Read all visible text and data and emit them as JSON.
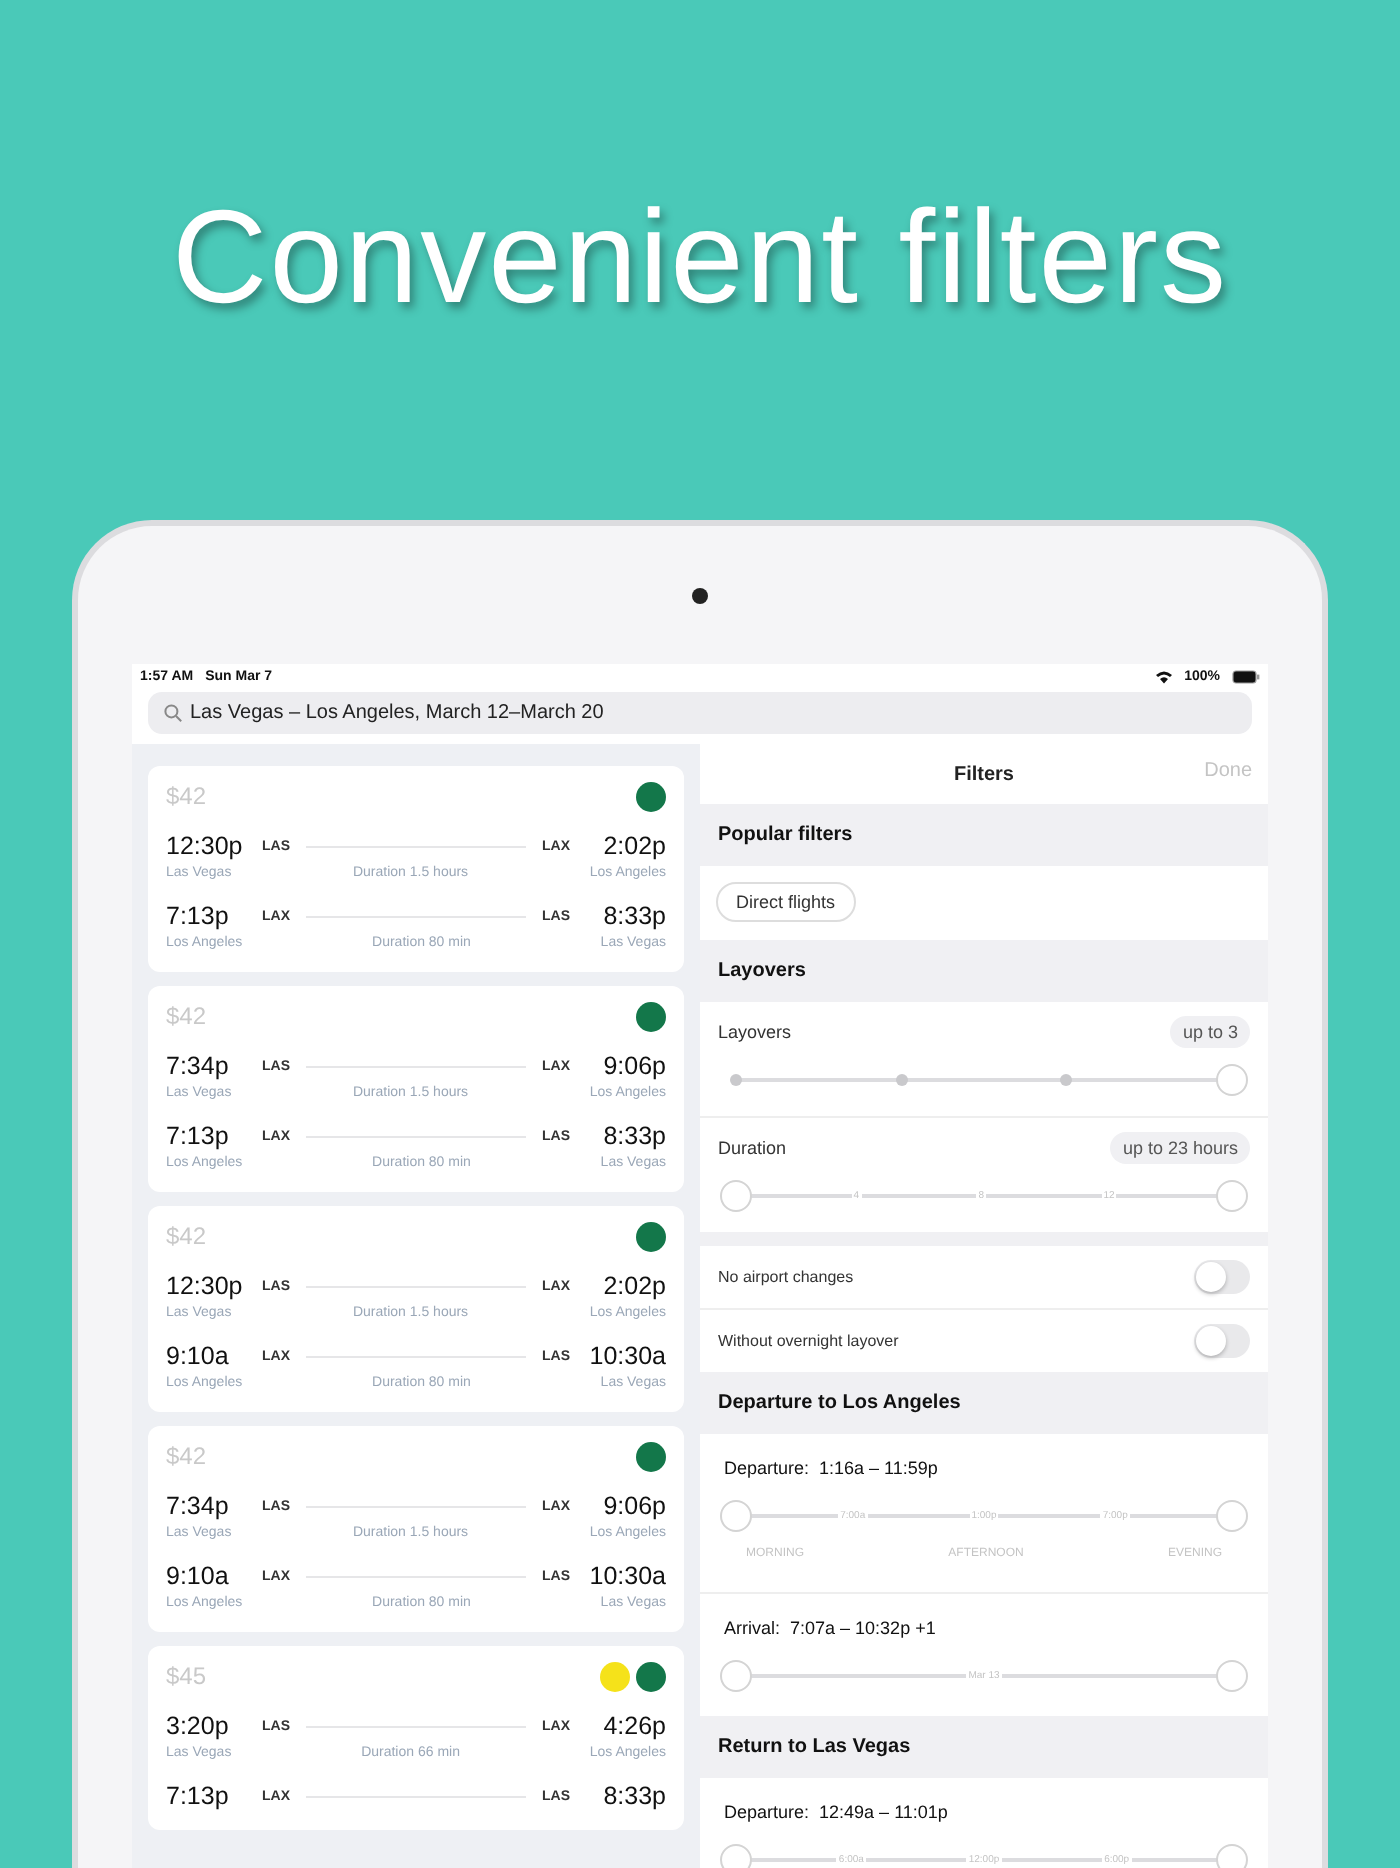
{
  "headline": "Convenient filters",
  "status_bar": {
    "time": "1:57 AM",
    "date": "Sun Mar 7",
    "battery": "100%"
  },
  "search": {
    "value": "Las Vegas – Los Angeles, March 12–March 20"
  },
  "results": [
    {
      "price": "$42",
      "airlines": [
        {
          "color": "#13774a"
        }
      ],
      "legs": [
        {
          "depart_time": "12:30p",
          "depart_code": "LAS",
          "arrive_code": "LAX",
          "arrive_time": "2:02p",
          "depart_city": "Las Vegas",
          "duration": "Duration 1.5 hours",
          "arrive_city": "Los Angeles"
        },
        {
          "depart_time": "7:13p",
          "depart_code": "LAX",
          "arrive_code": "LAS",
          "arrive_time": "8:33p",
          "depart_city": "Los Angeles",
          "duration": "Duration 80 min",
          "arrive_city": "Las Vegas"
        }
      ]
    },
    {
      "price": "$42",
      "airlines": [
        {
          "color": "#13774a"
        }
      ],
      "legs": [
        {
          "depart_time": "7:34p",
          "depart_code": "LAS",
          "arrive_code": "LAX",
          "arrive_time": "9:06p",
          "depart_city": "Las Vegas",
          "duration": "Duration 1.5 hours",
          "arrive_city": "Los Angeles"
        },
        {
          "depart_time": "7:13p",
          "depart_code": "LAX",
          "arrive_code": "LAS",
          "arrive_time": "8:33p",
          "depart_city": "Los Angeles",
          "duration": "Duration 80 min",
          "arrive_city": "Las Vegas"
        }
      ]
    },
    {
      "price": "$42",
      "airlines": [
        {
          "color": "#13774a"
        }
      ],
      "legs": [
        {
          "depart_time": "12:30p",
          "depart_code": "LAS",
          "arrive_code": "LAX",
          "arrive_time": "2:02p",
          "depart_city": "Las Vegas",
          "duration": "Duration 1.5 hours",
          "arrive_city": "Los Angeles"
        },
        {
          "depart_time": "9:10a",
          "depart_code": "LAX",
          "arrive_code": "LAS",
          "arrive_time": "10:30a",
          "depart_city": "Los Angeles",
          "duration": "Duration 80 min",
          "arrive_city": "Las Vegas"
        }
      ]
    },
    {
      "price": "$42",
      "airlines": [
        {
          "color": "#13774a"
        }
      ],
      "legs": [
        {
          "depart_time": "7:34p",
          "depart_code": "LAS",
          "arrive_code": "LAX",
          "arrive_time": "9:06p",
          "depart_city": "Las Vegas",
          "duration": "Duration 1.5 hours",
          "arrive_city": "Los Angeles"
        },
        {
          "depart_time": "9:10a",
          "depart_code": "LAX",
          "arrive_code": "LAS",
          "arrive_time": "10:30a",
          "depart_city": "Los Angeles",
          "duration": "Duration 80 min",
          "arrive_city": "Las Vegas"
        }
      ]
    },
    {
      "price": "$45",
      "airlines": [
        {
          "color": "#f5e21a"
        },
        {
          "color": "#13774a"
        }
      ],
      "legs": [
        {
          "depart_time": "3:20p",
          "depart_code": "LAS",
          "arrive_code": "LAX",
          "arrive_time": "4:26p",
          "depart_city": "Las Vegas",
          "duration": "Duration 66 min",
          "arrive_city": "Los Angeles"
        },
        {
          "depart_time": "7:13p",
          "depart_code": "LAX",
          "arrive_code": "LAS",
          "arrive_time": "8:33p"
        }
      ]
    }
  ],
  "filters": {
    "title": "Filters",
    "done": "Done",
    "sections": [
      {
        "heading": "Popular filters",
        "rows": [
          {
            "kind": "chips",
            "chips": [
              {
                "label": "Direct flights",
                "selected": false
              }
            ]
          }
        ]
      },
      {
        "heading": "Layovers",
        "rows": [
          {
            "kind": "slider",
            "label": "Layovers",
            "value": "up to 3",
            "stops": [
              {
                "level": 0
              },
              {
                "level": 0.333
              },
              {
                "level": 0.667
              }
            ],
            "thumbs": [
              {
                "level": 1
              }
            ]
          },
          {
            "kind": "slider",
            "label": "Duration",
            "value": "up to 23 hours",
            "ticks": [
              "4",
              "8",
              "12"
            ],
            "thumbs": [
              {
                "level": 0
              },
              {
                "level": 1
              }
            ]
          }
        ]
      },
      {
        "rows": [
          {
            "kind": "toggle",
            "label": "No airport changes",
            "on": false
          },
          {
            "kind": "toggle",
            "label": "Without overnight layover",
            "on": false
          }
        ]
      },
      {
        "heading": "Departure to Los Angeles",
        "rows": [
          {
            "kind": "time_range",
            "label": "Departure:",
            "value": "1:16a – 11:59p",
            "ticks": [
              "7:00a",
              "1:00p",
              "7:00p"
            ],
            "captions": [
              "MORNING",
              "AFTERNOON",
              "EVENING"
            ],
            "thumbs": [
              {
                "level": 0
              },
              {
                "level": 1
              }
            ]
          },
          {
            "kind": "time_range",
            "label": "Arrival:",
            "value": "7:07a – 10:32p +1",
            "ticks": [
              "Mar 13"
            ],
            "thumbs": [
              {
                "level": 0
              },
              {
                "level": 1
              }
            ]
          }
        ]
      },
      {
        "heading": "Return to Las Vegas",
        "rows": [
          {
            "kind": "time_range",
            "label": "Departure:",
            "value": "12:49a – 11:01p",
            "ticks": [
              "6:00a",
              "12:00p",
              "6:00p"
            ],
            "thumbs": [
              {
                "level": 0
              },
              {
                "level": 1
              }
            ]
          }
        ]
      }
    ]
  }
}
